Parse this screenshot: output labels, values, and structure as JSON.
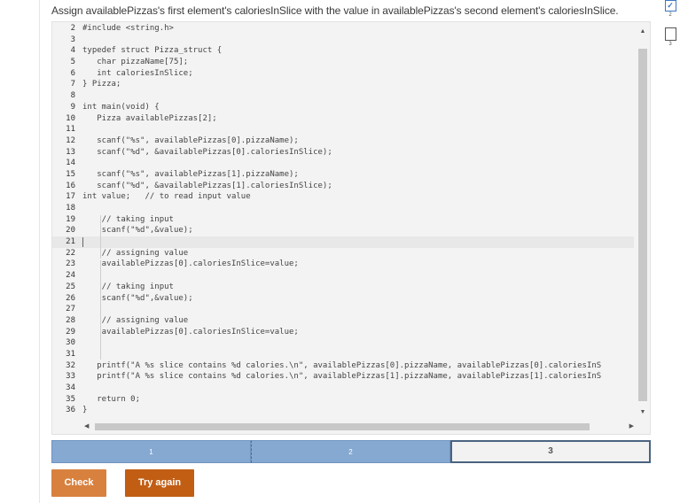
{
  "instructions": "Assign availablePizzas's first element's caloriesInSlice with the value in availablePizzas's second element's caloriesInSlice.",
  "side_nav": {
    "items": [
      "2",
      "3"
    ]
  },
  "editor": {
    "active_line": "21",
    "lines": [
      {
        "n": "2",
        "t": "#include <string.h>"
      },
      {
        "n": "3",
        "t": ""
      },
      {
        "n": "4",
        "t": "typedef struct Pizza_struct {"
      },
      {
        "n": "5",
        "t": "   char pizzaName[75];"
      },
      {
        "n": "6",
        "t": "   int caloriesInSlice;"
      },
      {
        "n": "7",
        "t": "} Pizza;"
      },
      {
        "n": "8",
        "t": ""
      },
      {
        "n": "9",
        "t": "int main(void) {"
      },
      {
        "n": "10",
        "t": "   Pizza availablePizzas[2];"
      },
      {
        "n": "11",
        "t": ""
      },
      {
        "n": "12",
        "t": "   scanf(\"%s\", availablePizzas[0].pizzaName);"
      },
      {
        "n": "13",
        "t": "   scanf(\"%d\", &availablePizzas[0].caloriesInSlice);"
      },
      {
        "n": "14",
        "t": ""
      },
      {
        "n": "15",
        "t": "   scanf(\"%s\", availablePizzas[1].pizzaName);"
      },
      {
        "n": "16",
        "t": "   scanf(\"%d\", &availablePizzas[1].caloriesInSlice);"
      },
      {
        "n": "17",
        "t": "int value;   // to read input value"
      },
      {
        "n": "18",
        "t": ""
      },
      {
        "n": "19",
        "t": "    // taking input"
      },
      {
        "n": "20",
        "t": "    scanf(\"%d\",&value);"
      },
      {
        "n": "21",
        "t": ""
      },
      {
        "n": "22",
        "t": "    // assigning value"
      },
      {
        "n": "23",
        "t": "    availablePizzas[0].caloriesInSlice=value;"
      },
      {
        "n": "24",
        "t": ""
      },
      {
        "n": "25",
        "t": "    // taking input"
      },
      {
        "n": "26",
        "t": "    scanf(\"%d\",&value);"
      },
      {
        "n": "27",
        "t": ""
      },
      {
        "n": "28",
        "t": "    // assigning value"
      },
      {
        "n": "29",
        "t": "    availablePizzas[0].caloriesInSlice=value;"
      },
      {
        "n": "30",
        "t": ""
      },
      {
        "n": "31",
        "t": ""
      },
      {
        "n": "32",
        "t": "   printf(\"A %s slice contains %d calories.\\n\", availablePizzas[0].pizzaName, availablePizzas[0].caloriesInS"
      },
      {
        "n": "33",
        "t": "   printf(\"A %s slice contains %d calories.\\n\", availablePizzas[1].pizzaName, availablePizzas[1].caloriesInS"
      },
      {
        "n": "34",
        "t": ""
      },
      {
        "n": "35",
        "t": "   return 0;"
      },
      {
        "n": "36",
        "t": "}"
      }
    ]
  },
  "progress": {
    "steps": [
      "1",
      "2",
      "3"
    ],
    "current": "3"
  },
  "buttons": {
    "check": "Check",
    "try_again": "Try again"
  },
  "colors": {
    "step_done": "#86a9d1",
    "check": "#d8813f",
    "try_again": "#c15e14"
  }
}
